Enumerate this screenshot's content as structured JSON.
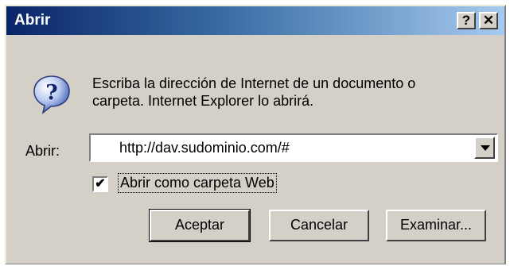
{
  "window": {
    "title": "Abrir",
    "help_label": "?",
    "close_label": "✕"
  },
  "message": {
    "line1": "Escriba la dirección de Internet de un documento o",
    "line2": "carpeta. Internet Explorer lo abrirá."
  },
  "open_field": {
    "label": "Abrir:",
    "value": "http://dav.sudominio.com/#"
  },
  "checkbox": {
    "label": "Abrir como carpeta Web",
    "checked": true,
    "check_glyph": "✔"
  },
  "buttons": {
    "ok": "Aceptar",
    "cancel": "Cancelar",
    "browse": "Examinar..."
  },
  "icons": [
    "question-icon",
    "dropdown-arrow-icon"
  ],
  "colors": {
    "dialog_bg": "#d4d0c8",
    "titlebar_start": "#0a246a",
    "titlebar_end": "#a6caf0"
  }
}
